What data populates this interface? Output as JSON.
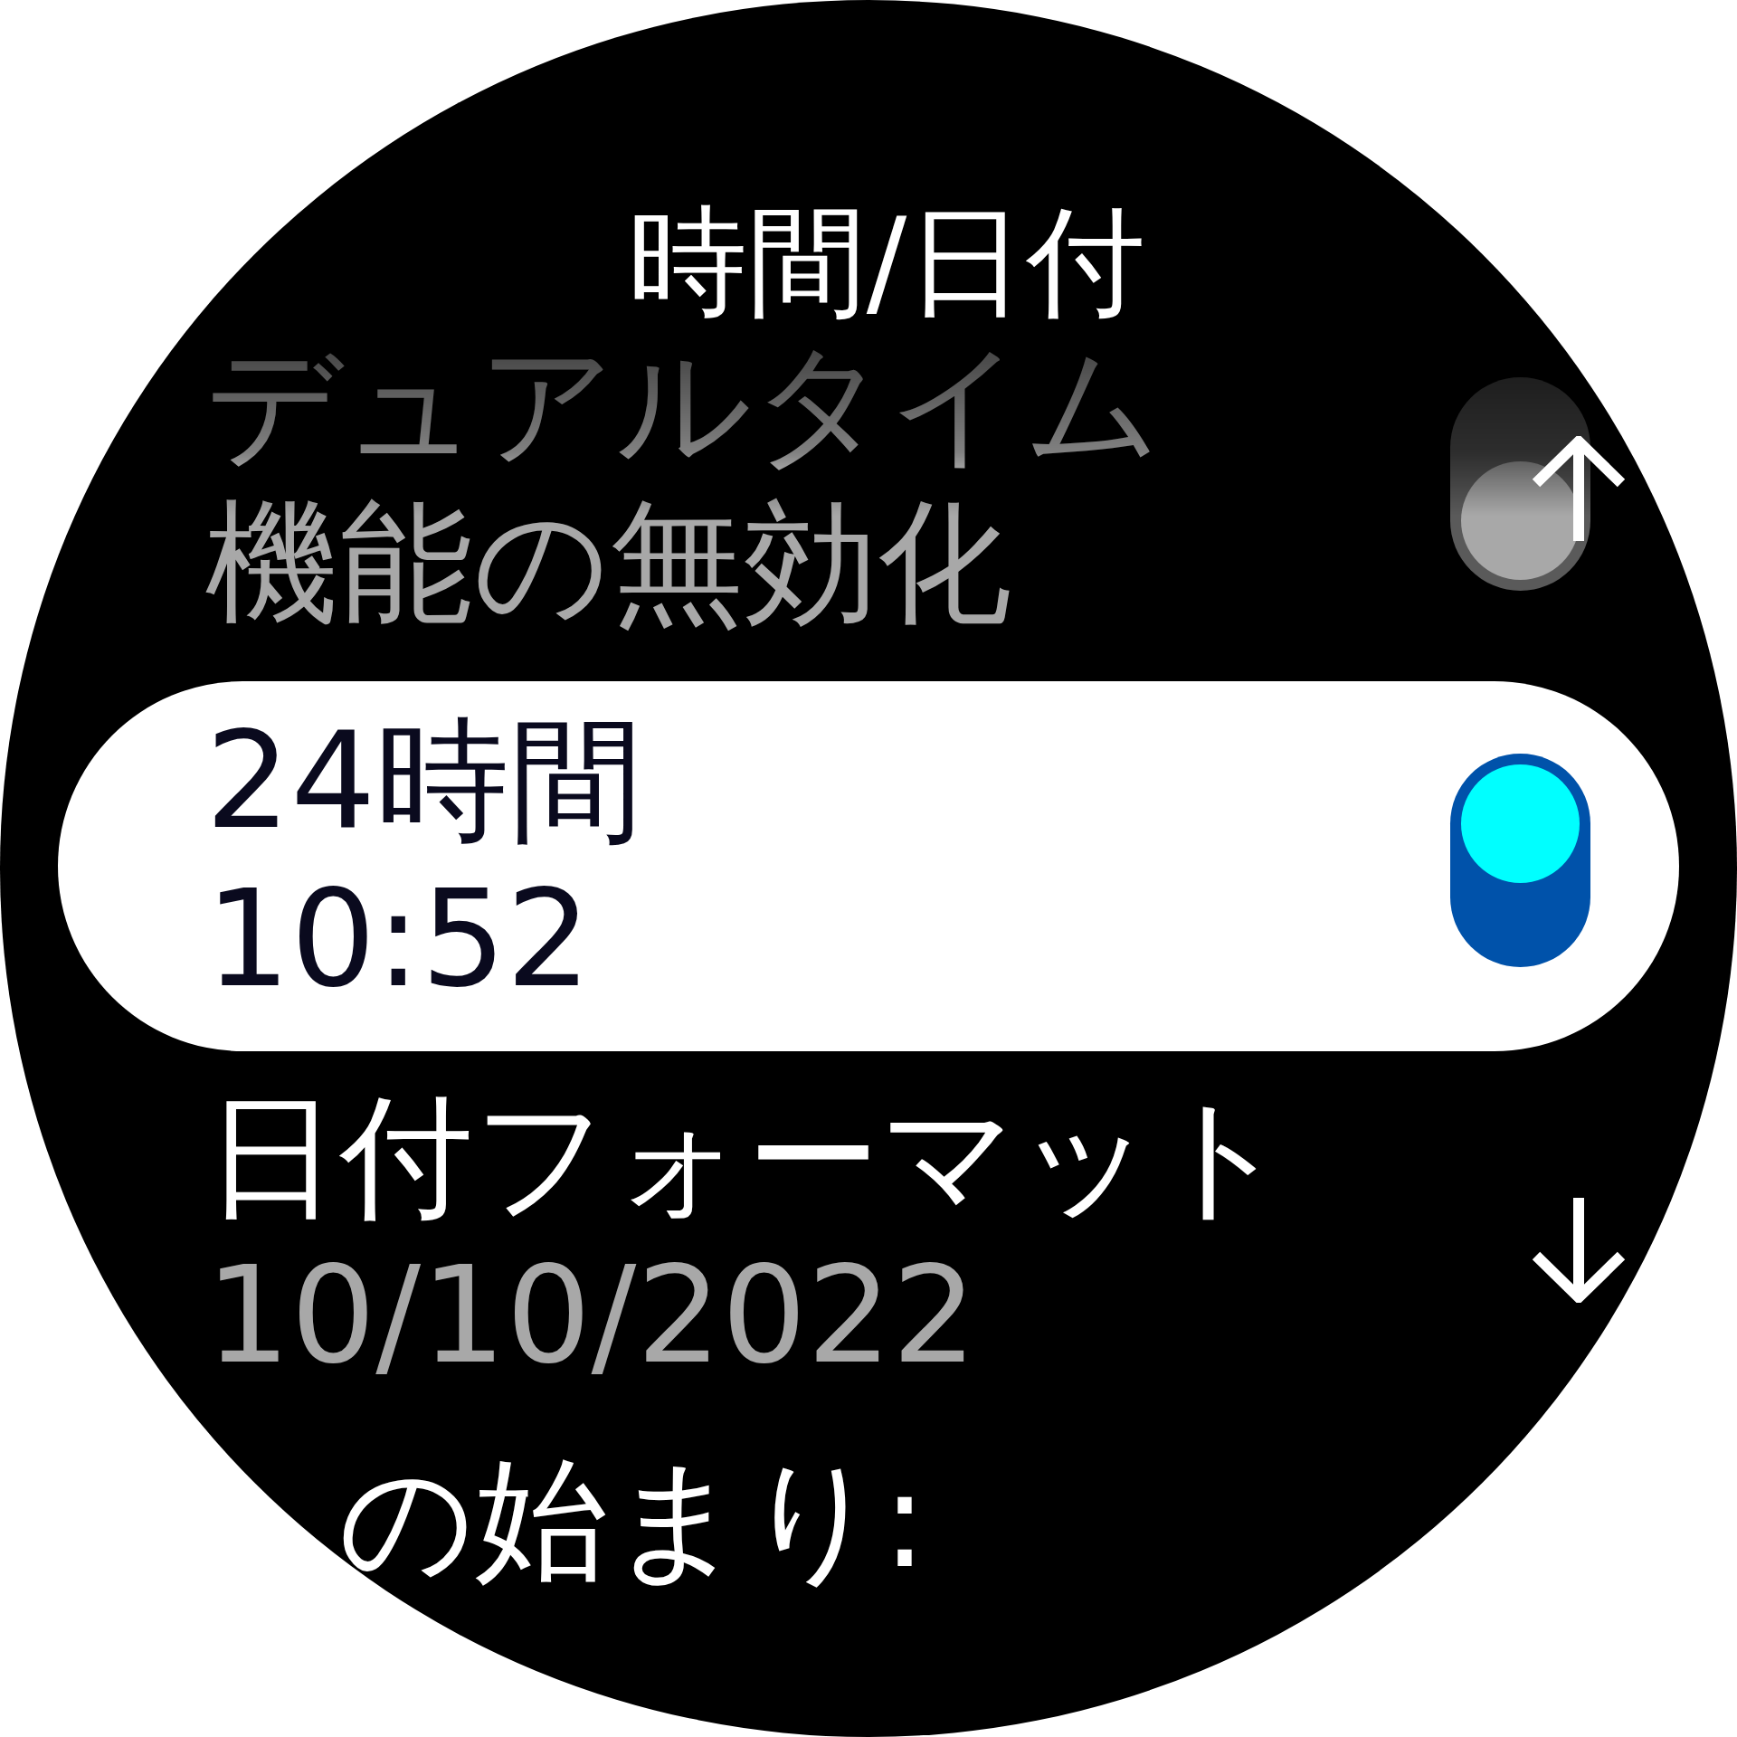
{
  "title": "時間/日付",
  "items": [
    {
      "kind": "toggle",
      "label": "デュアルタイム",
      "value": "機能の無効化",
      "on": false,
      "selected": false
    },
    {
      "kind": "toggle",
      "label": "24時間",
      "value": "10:52",
      "on": true,
      "selected": true
    },
    {
      "kind": "value",
      "label": "日付フォーマット",
      "value": "10/10/2022",
      "selected": false
    },
    {
      "kind": "value",
      "label": "の始まり:",
      "selected": false
    }
  ]
}
